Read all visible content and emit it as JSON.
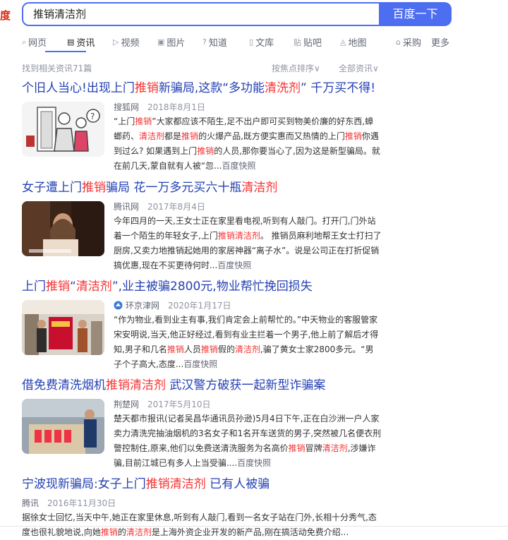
{
  "logo": {
    "fragment": "度"
  },
  "search": {
    "query": "推销清洁剂",
    "button": "百度一下"
  },
  "tabs": [
    {
      "icon": "search-icon",
      "glyph": "⌕",
      "label": "网页"
    },
    {
      "icon": "news-icon",
      "glyph": "▤",
      "label": "资讯"
    },
    {
      "icon": "video-icon",
      "glyph": "▷",
      "label": "视频"
    },
    {
      "icon": "image-icon",
      "glyph": "▣",
      "label": "图片"
    },
    {
      "icon": "question-icon",
      "glyph": "?",
      "label": "知道"
    },
    {
      "icon": "doc-icon",
      "glyph": "▯",
      "label": "文库"
    },
    {
      "icon": "tieba-icon",
      "glyph": "贴",
      "label": "贴吧"
    },
    {
      "icon": "map-icon",
      "glyph": "◬",
      "label": "地图"
    },
    {
      "icon": "cart-icon",
      "glyph": "⌂",
      "label": "采购"
    },
    {
      "icon": "",
      "glyph": "",
      "label": "更多"
    }
  ],
  "meta": {
    "count": "找到相关资讯71篇",
    "sort": "按焦点排序∨",
    "filter": "全部资讯∨"
  },
  "results": [
    {
      "title": [
        {
          "t": "个旧人当心!出现上门"
        },
        {
          "t": "推销",
          "hl": true
        },
        {
          "t": "新骗局,这款“多功能"
        },
        {
          "t": "清洗剂",
          "hl": true
        },
        {
          "t": "” 千万买不得!"
        }
      ],
      "source": "搜狐网",
      "time": "2018年8月1日",
      "abstract": [
        {
          "t": "“上门"
        },
        {
          "t": "推销",
          "hl": true
        },
        {
          "t": "”大家都应该不陌生,足不出户即可买到物美价廉的好东西,蟑螂药、"
        },
        {
          "t": "清洁剂",
          "hl": true
        },
        {
          "t": "都是"
        },
        {
          "t": "推销",
          "hl": true
        },
        {
          "t": "的火爆产品,既方便实惠而又热情的上门"
        },
        {
          "t": "推销",
          "hl": true
        },
        {
          "t": "你遇到过么? 如果遇到上门"
        },
        {
          "t": "推销",
          "hl": true
        },
        {
          "t": "的人员,那你要当心了,因为这是新型骗局。就在前几天,蒙自就有人被“忽..."
        },
        {
          "t": "百度快照",
          "kz": true
        }
      ]
    },
    {
      "title": [
        {
          "t": "女子遭上门"
        },
        {
          "t": "推销",
          "hl": true
        },
        {
          "t": "骗局 花一万多元买六十瓶"
        },
        {
          "t": "清洁剂",
          "hl": true
        }
      ],
      "source": "腾讯网",
      "time": "2017年8月4日",
      "abstract": [
        {
          "t": "今年四月的一天,王女士正在家里看电视,听到有人敲门。打开门,门外站着一个陌生的年轻女子,上门"
        },
        {
          "t": "推销清洁剂",
          "hl": true
        },
        {
          "t": "。 推销员麻利地帮王女士打扫了厨房,又卖力地推销起她用的家居神器“离子水”。说是公司正在打折促销搞优惠,现在不买更待何时..."
        },
        {
          "t": "百度快照",
          "kz": true
        }
      ]
    },
    {
      "title": [
        {
          "t": "上门"
        },
        {
          "t": "推销",
          "hl": true
        },
        {
          "t": "“"
        },
        {
          "t": "清洁剂",
          "hl": true
        },
        {
          "t": "”,业主被骗2800元,物业帮忙挽回损失"
        }
      ],
      "source": "环京津网",
      "time": "2020年1月17日",
      "abstract": [
        {
          "t": "“作为物业,看到业主有事,我们肯定会上前帮忙的。”中天物业的客服管家宋安明说,当天,他正好经过,看到有业主拦着一个男子,他上前了解后才得知,男子和几名"
        },
        {
          "t": "推销",
          "hl": true
        },
        {
          "t": "人员"
        },
        {
          "t": "推销",
          "hl": true
        },
        {
          "t": "假的"
        },
        {
          "t": "清洁剂",
          "hl": true
        },
        {
          "t": ",骗了黄女士家2800多元。“男子个子高大,态度..."
        },
        {
          "t": "百度快照",
          "kz": true
        }
      ]
    },
    {
      "title": [
        {
          "t": "借免费清洗烟机"
        },
        {
          "t": "推销清洁剂",
          "hl": true
        },
        {
          "t": " 武汉警方破获一起新型诈骗案"
        }
      ],
      "source": "荆楚网",
      "time": "2017年5月10日",
      "abstract": [
        {
          "t": "楚天都市报讯(记者吴昌华通讯员孙逊)5月4日下午,正在白沙洲一户人家卖力清洗完抽油烟机的3名女子和1名开车送货的男子,突然被几名便衣刑警控制住,原来,他们以免费送清洗服务为名高价"
        },
        {
          "t": "推销",
          "hl": true
        },
        {
          "t": "冒牌"
        },
        {
          "t": "清洁剂",
          "hl": true
        },
        {
          "t": ",涉嫌诈骗,目前江城已有多人上当受骗...."
        },
        {
          "t": "百度快照",
          "kz": true
        }
      ]
    },
    {
      "title": [
        {
          "t": "宁波现新骗局:女子上门"
        },
        {
          "t": "推销清洁剂",
          "hl": true
        },
        {
          "t": " 已有人被骗"
        }
      ],
      "source": "腾讯",
      "time": "2016年11月30日",
      "abstract": [
        {
          "t": "据徐女士回忆,当天中午,她正在家里休息,听到有人敲门,看到一名女子站在门外,长相十分秀气,态度也很礼貌地说,向她"
        },
        {
          "t": "推销",
          "hl": true
        },
        {
          "t": "的"
        },
        {
          "t": "清洁剂",
          "hl": true
        },
        {
          "t": "是上海外资企业开发的新产品,刚在搞活动免费介绍..."
        }
      ]
    }
  ]
}
